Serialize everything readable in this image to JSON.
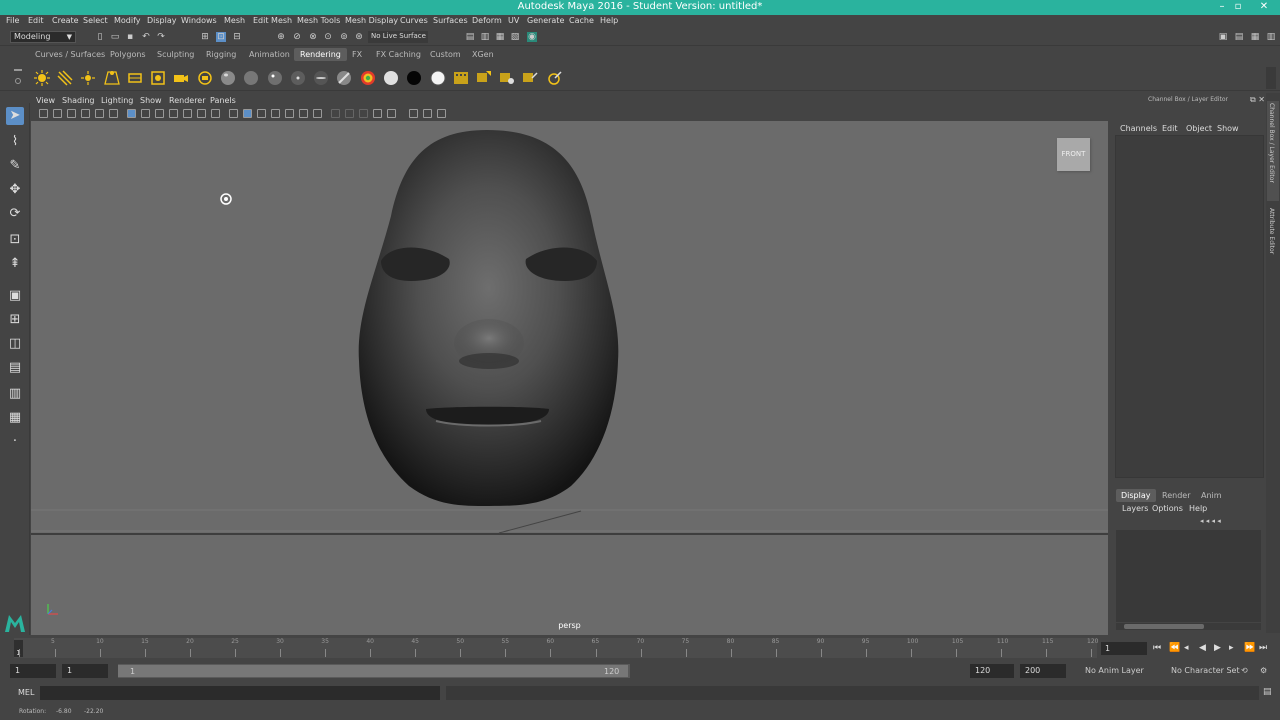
{
  "window": {
    "title": "Autodesk Maya 2016 - Student Version: untitled*"
  },
  "menubar": [
    "File",
    "Edit",
    "Create",
    "Select",
    "Modify",
    "Display",
    "Windows",
    "Mesh",
    "Edit Mesh",
    "Mesh Tools",
    "Mesh Display",
    "Curves",
    "Surfaces",
    "Deform",
    "UV",
    "Generate",
    "Cache",
    "Help"
  ],
  "status_line": {
    "mode": "Modeling",
    "live_surface": "No Live Surface"
  },
  "shelf": {
    "tabs": [
      "Curves / Surfaces",
      "Polygons",
      "Sculpting",
      "Rigging",
      "Animation",
      "Rendering",
      "FX",
      "FX Caching",
      "Custom",
      "XGen"
    ],
    "active_tab": "Rendering"
  },
  "viewport": {
    "menus": [
      "View",
      "Shading",
      "Lighting",
      "Show",
      "Renderer",
      "Panels"
    ],
    "camera": "persp",
    "viewcube_label": "FRONT"
  },
  "channel_box": {
    "title": "Channel Box / Layer Editor",
    "menus": [
      "Channels",
      "Edit",
      "Object",
      "Show"
    ]
  },
  "layer_editor": {
    "tabs": [
      "Display",
      "Render",
      "Anim"
    ],
    "active_tab": "Display",
    "menus": [
      "Layers",
      "Options",
      "Help"
    ]
  },
  "side_tabs": [
    "Channel Box / Layer Editor",
    "Attribute Editor"
  ],
  "timeline": {
    "ticks": [
      "1",
      "5",
      "10",
      "15",
      "20",
      "25",
      "30",
      "35",
      "40",
      "45",
      "50",
      "55",
      "60",
      "65",
      "70",
      "75",
      "80",
      "85",
      "90",
      "95",
      "100",
      "105",
      "110",
      "115",
      "120"
    ],
    "current_frame": "1",
    "current_frame_field": "1"
  },
  "range": {
    "start": "1",
    "playback_start": "1",
    "range_start_label": "1",
    "range_end_label": "120",
    "playback_end": "120",
    "end": "200",
    "anim_layer": "No Anim Layer",
    "character_set": "No Character Set"
  },
  "command_line": {
    "label": "MEL"
  },
  "help_line": {
    "label": "Rotation:",
    "x": "-6.80",
    "y": "-22.20"
  }
}
